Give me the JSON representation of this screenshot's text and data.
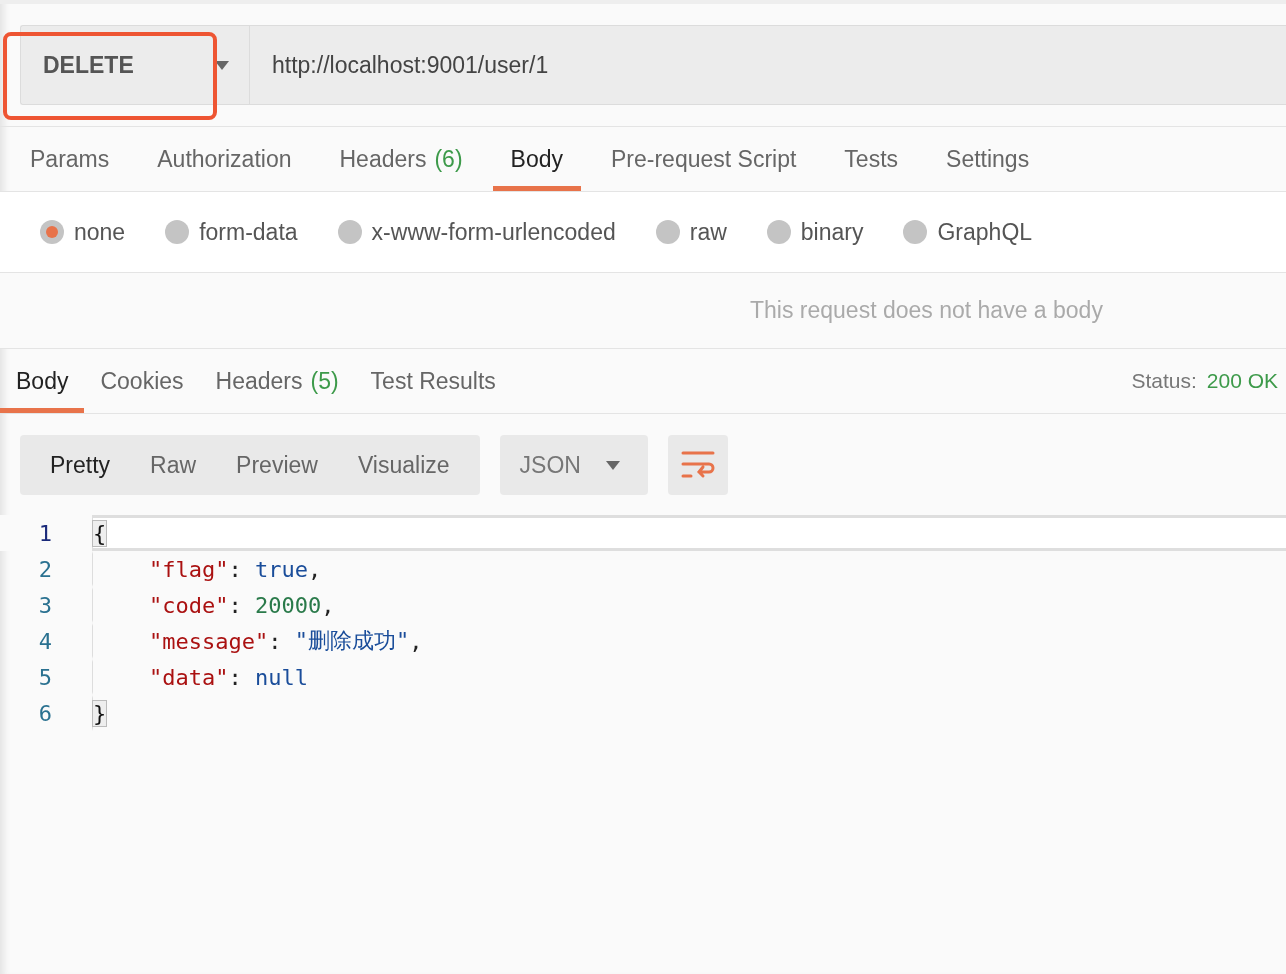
{
  "request": {
    "method": "DELETE",
    "method_annotated": true,
    "url": "http://localhost:9001/user/1"
  },
  "request_tabs": [
    {
      "label": "Params",
      "selected": false
    },
    {
      "label": "Authorization",
      "selected": false
    },
    {
      "label": "Headers",
      "count": "(6)",
      "selected": false
    },
    {
      "label": "Body",
      "selected": true
    },
    {
      "label": "Pre-request Script",
      "selected": false
    },
    {
      "label": "Tests",
      "selected": false
    },
    {
      "label": "Settings",
      "selected": false
    }
  ],
  "body_types": [
    {
      "label": "none",
      "selected": true
    },
    {
      "label": "form-data",
      "selected": false
    },
    {
      "label": "x-www-form-urlencoded",
      "selected": false
    },
    {
      "label": "raw",
      "selected": false
    },
    {
      "label": "binary",
      "selected": false
    },
    {
      "label": "GraphQL",
      "selected": false
    }
  ],
  "body_message": "This request does not have a body",
  "response_tabs": [
    {
      "label": "Body",
      "selected": true
    },
    {
      "label": "Cookies",
      "selected": false
    },
    {
      "label": "Headers",
      "count": "(5)",
      "selected": false
    },
    {
      "label": "Test Results",
      "selected": false
    }
  ],
  "status": {
    "label": "Status:",
    "value": "200 OK"
  },
  "view_modes": [
    {
      "label": "Pretty",
      "selected": true
    },
    {
      "label": "Raw",
      "selected": false
    },
    {
      "label": "Preview",
      "selected": false
    },
    {
      "label": "Visualize",
      "selected": false
    }
  ],
  "format": "JSON",
  "code_lines": [
    {
      "number": "1",
      "active": true,
      "indent": false,
      "tokens": [
        {
          "kind": "brace",
          "text": "{",
          "matched": true
        }
      ]
    },
    {
      "number": "2",
      "active": false,
      "indent": true,
      "tokens": [
        {
          "kind": "key",
          "text": "\"flag\""
        },
        {
          "kind": "punct",
          "text": ": "
        },
        {
          "kind": "keyword",
          "text": "true"
        },
        {
          "kind": "punct",
          "text": ","
        }
      ]
    },
    {
      "number": "3",
      "active": false,
      "indent": true,
      "tokens": [
        {
          "kind": "key",
          "text": "\"code\""
        },
        {
          "kind": "punct",
          "text": ": "
        },
        {
          "kind": "number",
          "text": "20000"
        },
        {
          "kind": "punct",
          "text": ","
        }
      ]
    },
    {
      "number": "4",
      "active": false,
      "indent": true,
      "tokens": [
        {
          "kind": "key",
          "text": "\"message\""
        },
        {
          "kind": "punct",
          "text": ": "
        },
        {
          "kind": "string",
          "text": "\"删除成功\""
        },
        {
          "kind": "punct",
          "text": ","
        }
      ]
    },
    {
      "number": "5",
      "active": false,
      "indent": true,
      "tokens": [
        {
          "kind": "key",
          "text": "\"data\""
        },
        {
          "kind": "punct",
          "text": ": "
        },
        {
          "kind": "keyword",
          "text": "null"
        }
      ]
    },
    {
      "number": "6",
      "active": false,
      "indent": false,
      "tokens": [
        {
          "kind": "brace",
          "text": "}",
          "matched": true
        }
      ]
    }
  ]
}
